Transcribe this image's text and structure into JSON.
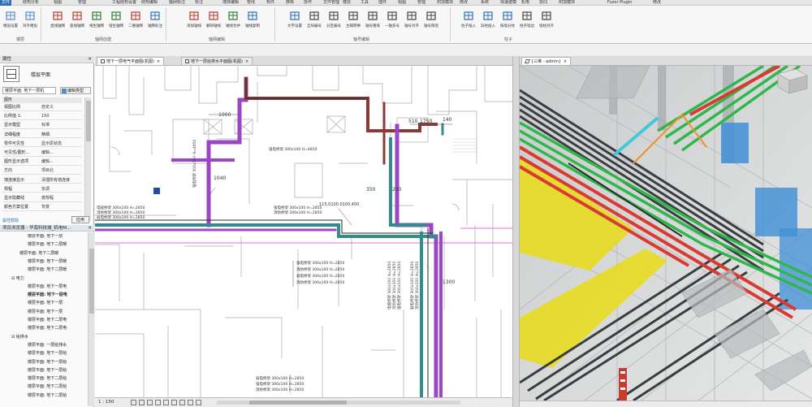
{
  "ribbon_tabs": [
    {
      "label": "文件",
      "active": true
    },
    {
      "label": "结构分析"
    },
    {
      "label": "视图"
    },
    {
      "label": "管理"
    },
    {
      "label": "工程结构设置"
    },
    {
      "label": "结构编辑"
    },
    {
      "label": "轴网标注"
    },
    {
      "label": "标注"
    },
    {
      "label": "墙体编辑"
    },
    {
      "label": "管线"
    },
    {
      "label": "构件"
    },
    {
      "label": "族库"
    },
    {
      "label": "协作"
    },
    {
      "label": "文件管理"
    },
    {
      "label": "楼层"
    },
    {
      "label": "工具"
    },
    {
      "label": "插件"
    },
    {
      "label": "视图"
    },
    {
      "label": "管理"
    },
    {
      "label": "附加模块"
    },
    {
      "label": "修改"
    },
    {
      "label": "系统"
    },
    {
      "label": "快速建模"
    },
    {
      "label": "机电"
    },
    {
      "label": "协同"
    },
    {
      "label": "附加模块"
    },
    {
      "label": "Fuzor Plugin"
    },
    {
      "label": "修改"
    }
  ],
  "ribbon_buttons": [
    {
      "label": "楼层设置",
      "icon": "floor-settings-icon"
    },
    {
      "label": "对齐楼层",
      "icon": "align-floor-icon"
    },
    {
      "label": "直线轴网",
      "icon": "line-grid-icon"
    },
    {
      "label": "弧线轴网",
      "icon": "arc-grid-icon"
    },
    {
      "label": "线生轴网",
      "icon": "line-to-grid-icon"
    },
    {
      "label": "墙生轴网",
      "icon": "wall-to-grid-icon"
    },
    {
      "label": "二维轴网",
      "icon": "2d-grid-icon"
    },
    {
      "label": "轴网标注",
      "icon": "grid-dim-icon"
    },
    {
      "label": "添加轴线",
      "icon": "add-axis-icon"
    },
    {
      "label": "删除轴线",
      "icon": "delete-axis-icon"
    },
    {
      "label": "轴线合并",
      "icon": "merge-axis-icon"
    },
    {
      "label": "轴线复制",
      "icon": "copy-axis-icon"
    },
    {
      "label": "文字设置",
      "icon": "text-settings-icon"
    },
    {
      "label": "全局编号",
      "icon": "global-number-icon"
    },
    {
      "label": "分区编号",
      "icon": "zone-number-icon"
    },
    {
      "label": "主辅转换",
      "icon": "main-aux-icon"
    },
    {
      "label": "轴号重排",
      "icon": "renumber-icon"
    },
    {
      "label": "一轴多号",
      "icon": "multi-number-icon"
    },
    {
      "label": "轴号对齐",
      "icon": "number-align-icon"
    },
    {
      "label": "轴号隐现",
      "icon": "number-toggle-icon"
    },
    {
      "label": "柱子插入",
      "icon": "column-insert-icon"
    },
    {
      "label": "异柱插入",
      "icon": "special-column-icon"
    },
    {
      "label": "按墙分柱",
      "icon": "wall-column-icon"
    },
    {
      "label": "柱齐墙边",
      "icon": "column-align-icon"
    },
    {
      "label": "墙柱对齐",
      "icon": "wall-column-align-icon"
    }
  ],
  "ribbon_groups": [
    {
      "label": "楼层"
    },
    {
      "label": "轴网创建"
    },
    {
      "label": "轴网编辑"
    },
    {
      "label": "轴号编辑"
    },
    {
      "label": "柱子"
    }
  ],
  "properties_panel": {
    "title": "属性",
    "type_label": "楼层平面",
    "instance_selector": "楼层平面: 地下一层机",
    "edit_type": "编辑类型",
    "section": "图形",
    "rows": [
      {
        "key": "视图比例",
        "value": "自定义"
      },
      {
        "key": "比例值 1:",
        "value": "150"
      },
      {
        "key": "显示模型",
        "value": "标准"
      },
      {
        "key": "详细程度",
        "value": "精细"
      },
      {
        "key": "零件可见性",
        "value": "显示原状态"
      },
      {
        "key": "可见性/图形...",
        "value": "编辑..."
      },
      {
        "key": "图形显示选项",
        "value": "编辑..."
      },
      {
        "key": "方向",
        "value": "项目北"
      },
      {
        "key": "墙连接显示",
        "value": "清理所有墙连接"
      },
      {
        "key": "规程",
        "value": "协调"
      },
      {
        "key": "显示隐藏线",
        "value": "按规程"
      },
      {
        "key": "颜色方案位置",
        "value": "背景"
      }
    ],
    "help_link": "属性帮助",
    "apply": "应用"
  },
  "project_browser": {
    "title": "项目浏览器 - 华南科技城_机电M...",
    "items": [
      {
        "indent": 3,
        "label": "楼层平面: 地下一层",
        "bold": false
      },
      {
        "indent": 3,
        "label": "楼层平面: 地下二层暖",
        "bold": false
      },
      {
        "indent": 2,
        "label": "楼层平面: 地下二层暖",
        "bold": false
      },
      {
        "indent": 3,
        "label": "楼层平面: 地下一层暖",
        "bold": false
      },
      {
        "indent": 3,
        "label": "楼层平面: 地下二层暖",
        "bold": false
      },
      {
        "indent": 1,
        "label": "电力",
        "bold": false
      },
      {
        "indent": 3,
        "label": "楼层平面: 地下一层电",
        "bold": false
      },
      {
        "indent": 3,
        "label": "楼层平面: 地下一层电",
        "bold": true
      },
      {
        "indent": 3,
        "label": "楼层平面: 地下一层",
        "bold": false
      },
      {
        "indent": 3,
        "label": "楼层平面: 地下一层",
        "bold": false
      },
      {
        "indent": 3,
        "label": "楼层平面: 地下二层电",
        "bold": false
      },
      {
        "indent": 3,
        "label": "楼层平面: 地下二层电",
        "bold": false
      },
      {
        "indent": 1,
        "label": "给排水",
        "bold": false
      },
      {
        "indent": 3,
        "label": "楼层平面: 一层给排水",
        "bold": false
      },
      {
        "indent": 3,
        "label": "楼层平面: 地下一层给",
        "bold": false
      },
      {
        "indent": 3,
        "label": "楼层平面: 地下一层给",
        "bold": false
      },
      {
        "indent": 3,
        "label": "楼层平面: 地下一层给",
        "bold": false
      },
      {
        "indent": 3,
        "label": "楼层平面: 地下二层给",
        "bold": false
      },
      {
        "indent": 3,
        "label": "楼层平面: 地下二层给",
        "bold": false
      },
      {
        "indent": 3,
        "label": "楼层平面: 地下二层给",
        "bold": false
      }
    ]
  },
  "view_tabs": {
    "plan_1": "地下一层电气平面图(机图)",
    "plan_2": "地下一层给排水平面图(机图)",
    "iso": "{三维 - admin}"
  },
  "plan_annotations": [
    "1000",
    "1750",
    "140",
    "510",
    "1040",
    "350",
    "250",
    "1300",
    "115.0100.0100.450",
    "强电桥架 300x100 H=4850",
    "电缆桥架 300x100 H=2850",
    "消防桥架 300x100 H=2850",
    "弱电桥架 300x100 H=2850",
    "强电桥架 300x100 H=2850",
    "消防桥架 200x100 H=2850",
    "强电桥架 300x100 H=2850",
    "消防桥架 300x100 H=2850",
    "弱电桥架 300x100 H=2850",
    "消防桥架 300x100 H=2850",
    "弱电桥架 300x100 H=2850",
    "强电桥架 300x100 H=2850",
    "消防桥架 300x100 H=2850"
  ],
  "status": {
    "scale": "1 : 150"
  },
  "colors": {
    "ribbon_active": "#2f6fb5",
    "tray_purple": "#9b46c2",
    "tray_teal": "#2f8d8a",
    "tray_brown": "#8c3a36",
    "pipe_green": "#2fb84a",
    "pipe_red": "#d93b33",
    "pipe_yellow": "#e8dc21",
    "pipe_cyan": "#40c9d6"
  }
}
